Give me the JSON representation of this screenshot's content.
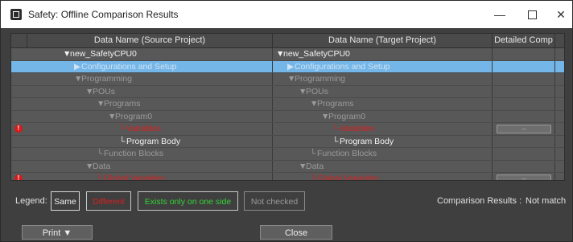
{
  "window": {
    "title": "Safety: Offline Comparison Results",
    "controls": {
      "minimize": "—",
      "close": "✕"
    }
  },
  "columns": [
    "",
    "Data Name (Source Project)",
    "Data Name (Target Project)",
    "Detailed Comp",
    ""
  ],
  "rows": [
    {
      "warn": false,
      "source": "new_SafetyCPU0",
      "target": "new_SafetyCPU0",
      "source_arrow": "▼",
      "target_arrow": "▼",
      "source_color": "white",
      "target_color": "white",
      "source_indent": 44,
      "target_indent": 4,
      "selected": false,
      "detail_button": false
    },
    {
      "warn": false,
      "source": "Configurations and Setup",
      "target": "Configurations and Setup",
      "source_arrow": "▶",
      "target_arrow": "▶",
      "source_color": "light",
      "target_color": "light",
      "source_indent": 58,
      "target_indent": 18,
      "selected": true,
      "detail_button": false
    },
    {
      "warn": false,
      "source": "Programming",
      "target": "Programming",
      "source_arrow": "▼",
      "target_arrow": "▼",
      "source_color": "gray",
      "target_color": "gray",
      "source_indent": 58,
      "target_indent": 18,
      "selected": false,
      "detail_button": false
    },
    {
      "warn": false,
      "source": "POUs",
      "target": "POUs",
      "source_arrow": "▼",
      "target_arrow": "▼",
      "source_color": "gray",
      "target_color": "gray",
      "source_indent": 72,
      "target_indent": 32,
      "selected": false,
      "detail_button": false
    },
    {
      "warn": false,
      "source": "Programs",
      "target": "Programs",
      "source_arrow": "▼",
      "target_arrow": "▼",
      "source_color": "gray",
      "target_color": "gray",
      "source_indent": 86,
      "target_indent": 46,
      "selected": false,
      "detail_button": false
    },
    {
      "warn": false,
      "source": "Program0",
      "target": "Program0",
      "source_arrow": "▼",
      "target_arrow": "▼",
      "source_color": "gray",
      "target_color": "gray",
      "source_indent": 100,
      "target_indent": 60,
      "selected": false,
      "detail_button": false
    },
    {
      "warn": true,
      "source": "Variables",
      "target": "Variables",
      "source_arrow": "└",
      "target_arrow": "└",
      "source_color": "red",
      "target_color": "red",
      "source_indent": 114,
      "target_indent": 74,
      "selected": false,
      "detail_button": true
    },
    {
      "warn": false,
      "source": "Program Body",
      "target": "Program Body",
      "source_arrow": "└",
      "target_arrow": "└",
      "source_color": "white",
      "target_color": "white",
      "source_indent": 114,
      "target_indent": 74,
      "selected": false,
      "detail_button": false
    },
    {
      "warn": false,
      "source": "Function Blocks",
      "target": "Function Blocks",
      "source_arrow": "└",
      "target_arrow": "└",
      "source_color": "gray",
      "target_color": "gray",
      "source_indent": 86,
      "target_indent": 46,
      "selected": false,
      "detail_button": false
    },
    {
      "warn": false,
      "source": "Data",
      "target": "Data",
      "source_arrow": "▼",
      "target_arrow": "▼",
      "source_color": "gray",
      "target_color": "gray",
      "source_indent": 72,
      "target_indent": 32,
      "selected": false,
      "detail_button": false
    },
    {
      "warn": true,
      "source": "Global Variables",
      "target": "Global Variables",
      "source_arrow": "└",
      "target_arrow": "└",
      "source_color": "red",
      "target_color": "red",
      "source_indent": 86,
      "target_indent": 46,
      "selected": false,
      "detail_button": true
    }
  ],
  "detail_button_label": "...",
  "warn_icon_glyph": "!",
  "legend": {
    "label": "Legend:",
    "same": "Same",
    "different": "Different",
    "one_side": "Exists only on one side",
    "not_checked": "Not checked"
  },
  "result": {
    "label": "Comparison Results :",
    "value": "Not match"
  },
  "buttons": {
    "print": "Print ▼",
    "close": "Close"
  },
  "colors": {
    "different": "#d92020",
    "one_side": "#35d335",
    "selected_row": "#74b6e8"
  }
}
